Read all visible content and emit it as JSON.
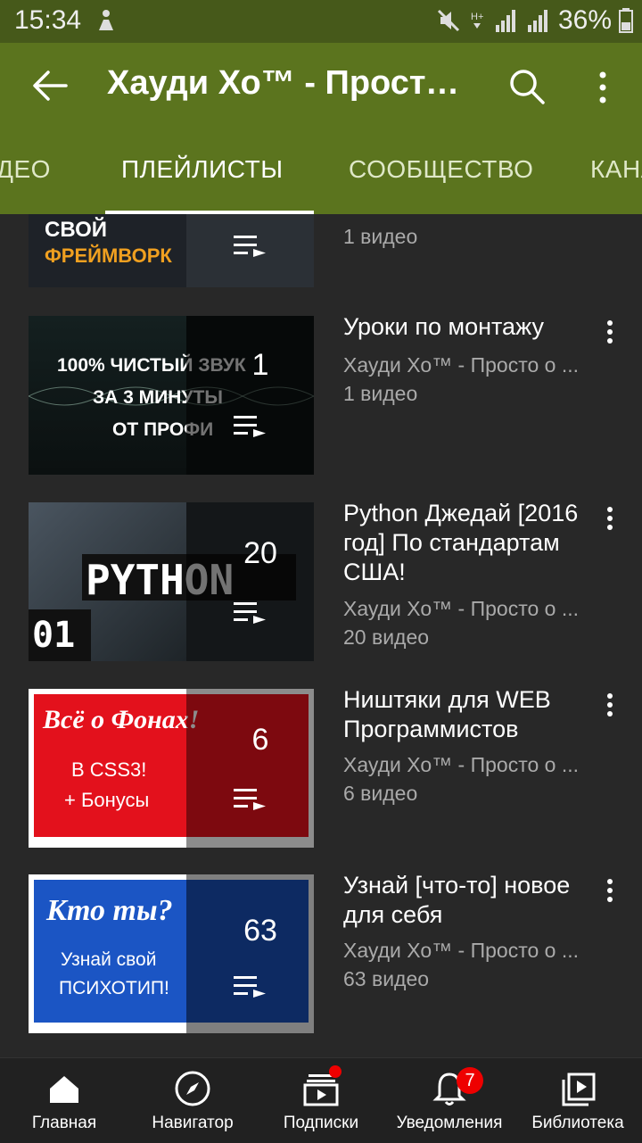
{
  "status_bar": {
    "time": "15:34",
    "battery": "36%"
  },
  "app_bar": {
    "title": "Хауди Хо™ - Просто..."
  },
  "tabs": [
    {
      "label": "ДЕО"
    },
    {
      "label": "ПЛЕЙЛИСТЫ",
      "active": true
    },
    {
      "label": "СООБЩЕСТВО"
    },
    {
      "label": "КАНА"
    }
  ],
  "playlists": [
    {
      "thumb_lines": [
        "СВОЙ",
        "ФРЕЙМВОРК"
      ],
      "name": "",
      "channel": "",
      "videos": "1 видео"
    },
    {
      "thumb_lines": [
        "100% ЧИСТЫЙ ЗВУК",
        "ЗА 3 МИНУТЫ",
        "ОТ ПРОФИ"
      ],
      "count": "1",
      "name": "Уроки по монтажу",
      "channel": "Хауди Хо™ - Просто о ...",
      "videos": "1 видео"
    },
    {
      "thumb_lines": [
        "PYTHON",
        "01"
      ],
      "count": "20",
      "name": "Python Джедай [2016 год] По стандартам США!",
      "channel": "Хауди Хо™ - Просто о ...",
      "videos": "20 видео"
    },
    {
      "thumb_lines": [
        "Всё о Фонах!",
        "В CSS3!",
        "+ Бонусы"
      ],
      "count": "6",
      "name": "Ништяки для WEB Программистов",
      "channel": "Хауди Хо™ - Просто о ...",
      "videos": "6 видео"
    },
    {
      "thumb_lines": [
        "Кто ты?",
        "Узнай свой",
        "ПСИХОТИП!"
      ],
      "count": "63",
      "name": "Узнай [что-то] новое для себя",
      "channel": "Хауди Хо™ - Просто о ...",
      "videos": "63 видео"
    }
  ],
  "bottom_nav": [
    {
      "label": "Главная",
      "icon": "home-icon"
    },
    {
      "label": "Навигатор",
      "icon": "compass-icon"
    },
    {
      "label": "Подписки",
      "icon": "subscriptions-icon",
      "dot": true
    },
    {
      "label": "Уведомления",
      "icon": "bell-icon",
      "badge": "7"
    },
    {
      "label": "Библиотека",
      "icon": "library-icon"
    }
  ],
  "colors": {
    "app_bar": "#5b741e",
    "status_bar": "#46591a",
    "background": "#282828",
    "badge": "#e00000"
  }
}
